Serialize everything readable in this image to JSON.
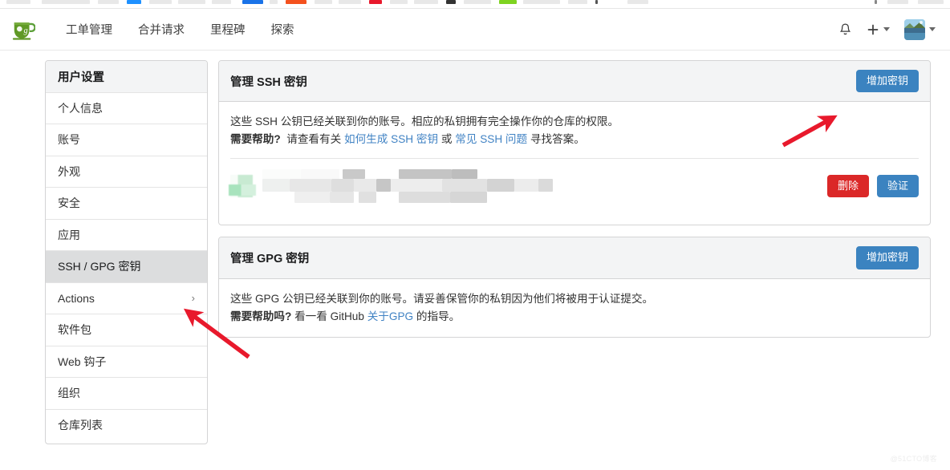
{
  "browser": {
    "bookmark_bar_visible": true
  },
  "topnav": {
    "logo_name": "gitea-logo",
    "links": [
      {
        "label": "工单管理",
        "name": "nav-issues"
      },
      {
        "label": "合并请求",
        "name": "nav-pull-requests"
      },
      {
        "label": "里程碑",
        "name": "nav-milestones"
      },
      {
        "label": "探索",
        "name": "nav-explore"
      }
    ],
    "notification_icon": "bell-icon",
    "create_icon": "plus-icon",
    "avatar_name": "user-avatar"
  },
  "sidebar": {
    "header": "用户设置",
    "items": [
      {
        "label": "个人信息",
        "name": "sidebar-item-profile",
        "active": false,
        "chevron": ""
      },
      {
        "label": "账号",
        "name": "sidebar-item-account",
        "active": false,
        "chevron": ""
      },
      {
        "label": "外观",
        "name": "sidebar-item-appearance",
        "active": false,
        "chevron": ""
      },
      {
        "label": "安全",
        "name": "sidebar-item-security",
        "active": false,
        "chevron": ""
      },
      {
        "label": "应用",
        "name": "sidebar-item-applications",
        "active": false,
        "chevron": ""
      },
      {
        "label": "SSH / GPG 密钥",
        "name": "sidebar-item-ssh-gpg-keys",
        "active": true,
        "chevron": ""
      },
      {
        "label": "Actions",
        "name": "sidebar-item-actions",
        "active": false,
        "chevron": "›"
      },
      {
        "label": "软件包",
        "name": "sidebar-item-packages",
        "active": false,
        "chevron": ""
      },
      {
        "label": "Web 钩子",
        "name": "sidebar-item-webhooks",
        "active": false,
        "chevron": ""
      },
      {
        "label": "组织",
        "name": "sidebar-item-organizations",
        "active": false,
        "chevron": ""
      },
      {
        "label": "仓库列表",
        "name": "sidebar-item-repositories",
        "active": false,
        "chevron": ""
      }
    ]
  },
  "ssh_panel": {
    "title": "管理 SSH 密钥",
    "add_button": "增加密钥",
    "description": "这些 SSH 公钥已经关联到你的账号。相应的私钥拥有完全操作你的仓库的权限。",
    "help_label": "需要帮助?",
    "help_prefix": "请查看有关",
    "help_link_1": "如何生成 SSH 密钥",
    "help_conj": "或",
    "help_link_2": "常见 SSH 问题",
    "help_suffix": "寻找答案。",
    "key_row": {
      "redacted": true,
      "icon_name": "ssh-key-icon",
      "delete_button": "删除",
      "verify_button": "验证"
    }
  },
  "gpg_panel": {
    "title": "管理 GPG 密钥",
    "add_button": "增加密钥",
    "description": "这些 GPG 公钥已经关联到你的账号。请妥善保管你的私钥因为他们将被用于认证提交。",
    "help_label": "需要帮助吗?",
    "help_prefix": "看一看 GitHub",
    "help_link_1": "关于GPG",
    "help_suffix": "的指导。"
  },
  "annotations": [
    {
      "name": "arrow-to-add-ssh-key-button",
      "color": "#e8192c",
      "points_to": "增加密钥"
    },
    {
      "name": "arrow-to-ssh-gpg-keys-sidebar-item",
      "color": "#e8192c",
      "points_to": "SSH / GPG 密钥"
    }
  ],
  "watermark": {
    "text": "@51CTO博客"
  },
  "colors": {
    "accent_blue": "#3b83c0",
    "link_blue": "#4183c4",
    "danger_red": "#db2828",
    "annotation_red": "#e8192c",
    "panel_header_bg": "#f3f4f5",
    "sidebar_active_bg": "#dcddde",
    "border": "#d4d4d5"
  }
}
